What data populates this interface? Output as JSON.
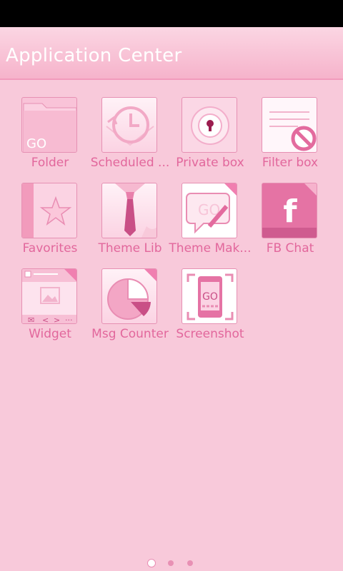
{
  "header": {
    "title": "Application Center"
  },
  "apps": [
    {
      "label": "Folder",
      "icon": "folder-icon"
    },
    {
      "label": "Scheduled ...",
      "icon": "scheduled-clock-icon"
    },
    {
      "label": "Private box",
      "icon": "private-box-lock-icon"
    },
    {
      "label": "Filter box",
      "icon": "filter-box-icon"
    },
    {
      "label": "Favorites",
      "icon": "favorites-star-icon"
    },
    {
      "label": "Theme Lib",
      "icon": "theme-lib-tie-icon"
    },
    {
      "label": "Theme Mak...",
      "icon": "theme-maker-icon"
    },
    {
      "label": "FB Chat",
      "icon": "facebook-chat-icon"
    },
    {
      "label": "Widget",
      "icon": "widget-icon"
    },
    {
      "label": "Msg Counter",
      "icon": "msg-counter-pie-icon"
    },
    {
      "label": "Screenshot",
      "icon": "screenshot-phone-icon"
    }
  ],
  "folder_badge": "GO",
  "theme_maker_badge": "GO",
  "screenshot_badge": "GO",
  "fb_letter": "f",
  "pagination": {
    "pages": 3,
    "current": 1
  },
  "colors": {
    "background": "#f8c9da",
    "label": "#e2679c",
    "accent": "#f07fb0"
  }
}
